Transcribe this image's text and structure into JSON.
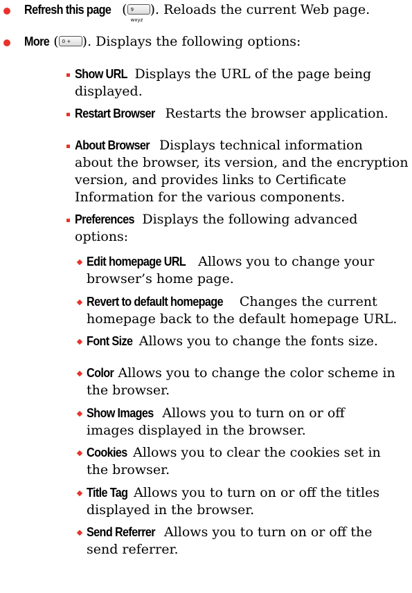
{
  "items": [
    {
      "term": "Refresh this page",
      "pre": " (",
      "key": "9 wxyz",
      "post": "). Reloads the current Web page."
    },
    {
      "term": "More",
      "pre": " (",
      "key": "0 +",
      "post": "). Displays the following options:"
    },
    {
      "term": "Show URL",
      "line1": " Displays the URL of the page being",
      "line2": "displayed."
    },
    {
      "term": "Restart Browser",
      "text": " Restarts the browser application."
    },
    {
      "term": "About Browser",
      "line1": " Displays technical information",
      "line2": "about the browser, its version, and the encryption",
      "line3": "version, and provides links to Certificate",
      "line4": "Information for the various components."
    },
    {
      "term": "Preferences",
      "line1": " Displays the following advanced",
      "line2": "options:"
    },
    {
      "term": "Edit homepage URL",
      "line1": " Allows you to change your",
      "line2": "browser’s home page."
    },
    {
      "term": "Revert to default homepage",
      "line1": " Changes the current",
      "line2": "homepage back to the default homepage URL."
    },
    {
      "term": "Font Size",
      "text": " Allows you to change the fonts size."
    },
    {
      "term": "Color",
      "line1": " Allows you to change the color scheme in",
      "line2": "the browser."
    },
    {
      "term": "Show Images",
      "line1": " Allows you to turn on or off",
      "line2": "images displayed in the browser."
    },
    {
      "term": "Cookies",
      "line1": " Allows you to clear the cookies set in",
      "line2": "the browser."
    },
    {
      "term": "Title Tag",
      "line1": " Allows you to turn on or off the titles",
      "line2": "displayed in the browser."
    },
    {
      "term": "Send Referrer",
      "line1": " Allows you to turn on or off the",
      "line2": "send referrer."
    }
  ],
  "colors": {
    "bullet": "#e8332a",
    "text": "#000000"
  }
}
